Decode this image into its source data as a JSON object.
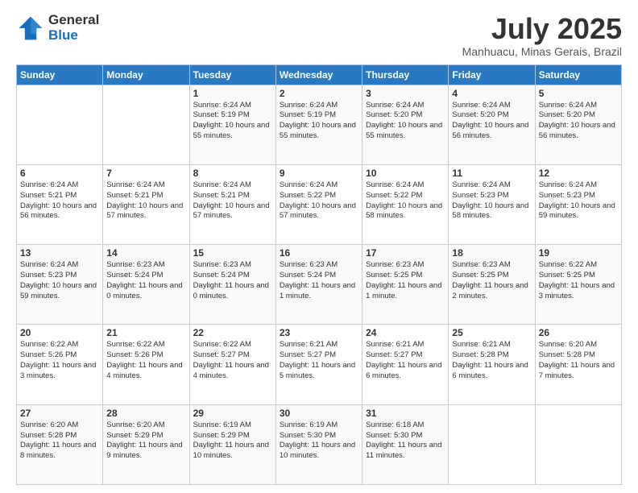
{
  "header": {
    "logo_general": "General",
    "logo_blue": "Blue",
    "month_title": "July 2025",
    "location": "Manhuacu, Minas Gerais, Brazil"
  },
  "days_of_week": [
    "Sunday",
    "Monday",
    "Tuesday",
    "Wednesday",
    "Thursday",
    "Friday",
    "Saturday"
  ],
  "weeks": [
    [
      {
        "day": "",
        "sunrise": "",
        "sunset": "",
        "daylight": ""
      },
      {
        "day": "",
        "sunrise": "",
        "sunset": "",
        "daylight": ""
      },
      {
        "day": "1",
        "sunrise": "Sunrise: 6:24 AM",
        "sunset": "Sunset: 5:19 PM",
        "daylight": "Daylight: 10 hours and 55 minutes."
      },
      {
        "day": "2",
        "sunrise": "Sunrise: 6:24 AM",
        "sunset": "Sunset: 5:19 PM",
        "daylight": "Daylight: 10 hours and 55 minutes."
      },
      {
        "day": "3",
        "sunrise": "Sunrise: 6:24 AM",
        "sunset": "Sunset: 5:20 PM",
        "daylight": "Daylight: 10 hours and 55 minutes."
      },
      {
        "day": "4",
        "sunrise": "Sunrise: 6:24 AM",
        "sunset": "Sunset: 5:20 PM",
        "daylight": "Daylight: 10 hours and 56 minutes."
      },
      {
        "day": "5",
        "sunrise": "Sunrise: 6:24 AM",
        "sunset": "Sunset: 5:20 PM",
        "daylight": "Daylight: 10 hours and 56 minutes."
      }
    ],
    [
      {
        "day": "6",
        "sunrise": "Sunrise: 6:24 AM",
        "sunset": "Sunset: 5:21 PM",
        "daylight": "Daylight: 10 hours and 56 minutes."
      },
      {
        "day": "7",
        "sunrise": "Sunrise: 6:24 AM",
        "sunset": "Sunset: 5:21 PM",
        "daylight": "Daylight: 10 hours and 57 minutes."
      },
      {
        "day": "8",
        "sunrise": "Sunrise: 6:24 AM",
        "sunset": "Sunset: 5:21 PM",
        "daylight": "Daylight: 10 hours and 57 minutes."
      },
      {
        "day": "9",
        "sunrise": "Sunrise: 6:24 AM",
        "sunset": "Sunset: 5:22 PM",
        "daylight": "Daylight: 10 hours and 57 minutes."
      },
      {
        "day": "10",
        "sunrise": "Sunrise: 6:24 AM",
        "sunset": "Sunset: 5:22 PM",
        "daylight": "Daylight: 10 hours and 58 minutes."
      },
      {
        "day": "11",
        "sunrise": "Sunrise: 6:24 AM",
        "sunset": "Sunset: 5:23 PM",
        "daylight": "Daylight: 10 hours and 58 minutes."
      },
      {
        "day": "12",
        "sunrise": "Sunrise: 6:24 AM",
        "sunset": "Sunset: 5:23 PM",
        "daylight": "Daylight: 10 hours and 59 minutes."
      }
    ],
    [
      {
        "day": "13",
        "sunrise": "Sunrise: 6:24 AM",
        "sunset": "Sunset: 5:23 PM",
        "daylight": "Daylight: 10 hours and 59 minutes."
      },
      {
        "day": "14",
        "sunrise": "Sunrise: 6:23 AM",
        "sunset": "Sunset: 5:24 PM",
        "daylight": "Daylight: 11 hours and 0 minutes."
      },
      {
        "day": "15",
        "sunrise": "Sunrise: 6:23 AM",
        "sunset": "Sunset: 5:24 PM",
        "daylight": "Daylight: 11 hours and 0 minutes."
      },
      {
        "day": "16",
        "sunrise": "Sunrise: 6:23 AM",
        "sunset": "Sunset: 5:24 PM",
        "daylight": "Daylight: 11 hours and 1 minute."
      },
      {
        "day": "17",
        "sunrise": "Sunrise: 6:23 AM",
        "sunset": "Sunset: 5:25 PM",
        "daylight": "Daylight: 11 hours and 1 minute."
      },
      {
        "day": "18",
        "sunrise": "Sunrise: 6:23 AM",
        "sunset": "Sunset: 5:25 PM",
        "daylight": "Daylight: 11 hours and 2 minutes."
      },
      {
        "day": "19",
        "sunrise": "Sunrise: 6:22 AM",
        "sunset": "Sunset: 5:25 PM",
        "daylight": "Daylight: 11 hours and 3 minutes."
      }
    ],
    [
      {
        "day": "20",
        "sunrise": "Sunrise: 6:22 AM",
        "sunset": "Sunset: 5:26 PM",
        "daylight": "Daylight: 11 hours and 3 minutes."
      },
      {
        "day": "21",
        "sunrise": "Sunrise: 6:22 AM",
        "sunset": "Sunset: 5:26 PM",
        "daylight": "Daylight: 11 hours and 4 minutes."
      },
      {
        "day": "22",
        "sunrise": "Sunrise: 6:22 AM",
        "sunset": "Sunset: 5:27 PM",
        "daylight": "Daylight: 11 hours and 4 minutes."
      },
      {
        "day": "23",
        "sunrise": "Sunrise: 6:21 AM",
        "sunset": "Sunset: 5:27 PM",
        "daylight": "Daylight: 11 hours and 5 minutes."
      },
      {
        "day": "24",
        "sunrise": "Sunrise: 6:21 AM",
        "sunset": "Sunset: 5:27 PM",
        "daylight": "Daylight: 11 hours and 6 minutes."
      },
      {
        "day": "25",
        "sunrise": "Sunrise: 6:21 AM",
        "sunset": "Sunset: 5:28 PM",
        "daylight": "Daylight: 11 hours and 6 minutes."
      },
      {
        "day": "26",
        "sunrise": "Sunrise: 6:20 AM",
        "sunset": "Sunset: 5:28 PM",
        "daylight": "Daylight: 11 hours and 7 minutes."
      }
    ],
    [
      {
        "day": "27",
        "sunrise": "Sunrise: 6:20 AM",
        "sunset": "Sunset: 5:28 PM",
        "daylight": "Daylight: 11 hours and 8 minutes."
      },
      {
        "day": "28",
        "sunrise": "Sunrise: 6:20 AM",
        "sunset": "Sunset: 5:29 PM",
        "daylight": "Daylight: 11 hours and 9 minutes."
      },
      {
        "day": "29",
        "sunrise": "Sunrise: 6:19 AM",
        "sunset": "Sunset: 5:29 PM",
        "daylight": "Daylight: 11 hours and 10 minutes."
      },
      {
        "day": "30",
        "sunrise": "Sunrise: 6:19 AM",
        "sunset": "Sunset: 5:30 PM",
        "daylight": "Daylight: 11 hours and 10 minutes."
      },
      {
        "day": "31",
        "sunrise": "Sunrise: 6:18 AM",
        "sunset": "Sunset: 5:30 PM",
        "daylight": "Daylight: 11 hours and 11 minutes."
      },
      {
        "day": "",
        "sunrise": "",
        "sunset": "",
        "daylight": ""
      },
      {
        "day": "",
        "sunrise": "",
        "sunset": "",
        "daylight": ""
      }
    ]
  ]
}
